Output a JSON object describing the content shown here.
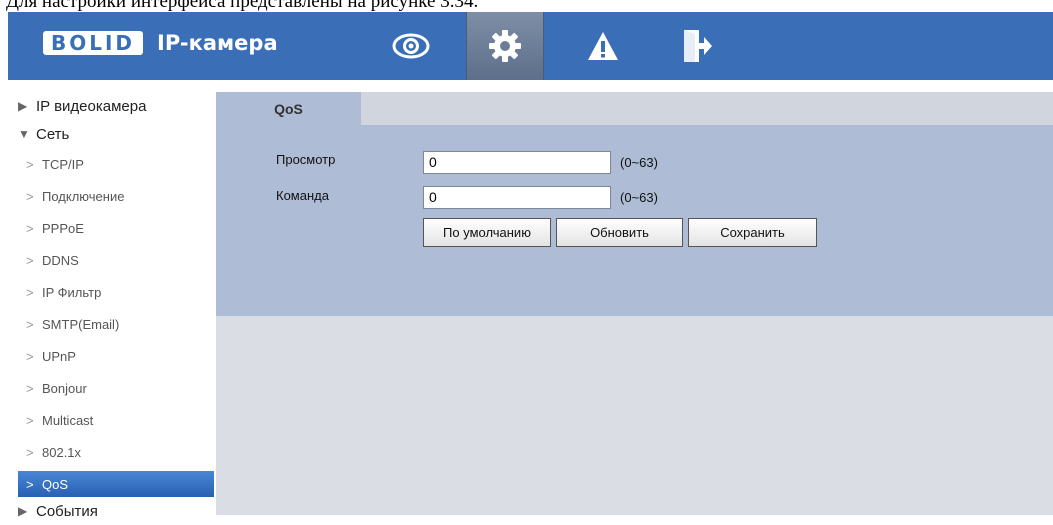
{
  "doc_caption": "Для настройки интерфейса представлены на рисунке 3.34.",
  "header": {
    "logo": "BOLID",
    "app_title": "IP-камера",
    "nav": [
      {
        "icon": "eye-icon",
        "active": false
      },
      {
        "icon": "gear-icon",
        "active": true
      },
      {
        "icon": "warning-icon",
        "active": false
      },
      {
        "icon": "logout-icon",
        "active": false
      }
    ],
    "accent": "#3a6fb8"
  },
  "sidebar": {
    "group_camera": "IP видеокамера",
    "group_network": "Сеть",
    "items": [
      "TCP/IP",
      "Подключение",
      "PPPoE",
      "DDNS",
      "IP Фильтр",
      "SMTP(Email)",
      "UPnP",
      "Bonjour",
      "Multicast",
      "802.1x",
      "QoS"
    ],
    "active_item": "QoS",
    "group_events": "События"
  },
  "tab": {
    "label": "QoS"
  },
  "form": {
    "preview_label": "Просмотр",
    "preview_value": "0",
    "preview_range": "(0~63)",
    "command_label": "Команда",
    "command_value": "0",
    "command_range": "(0~63)"
  },
  "buttons": {
    "default": "По умолчанию",
    "refresh": "Обновить",
    "save": "Сохранить"
  }
}
